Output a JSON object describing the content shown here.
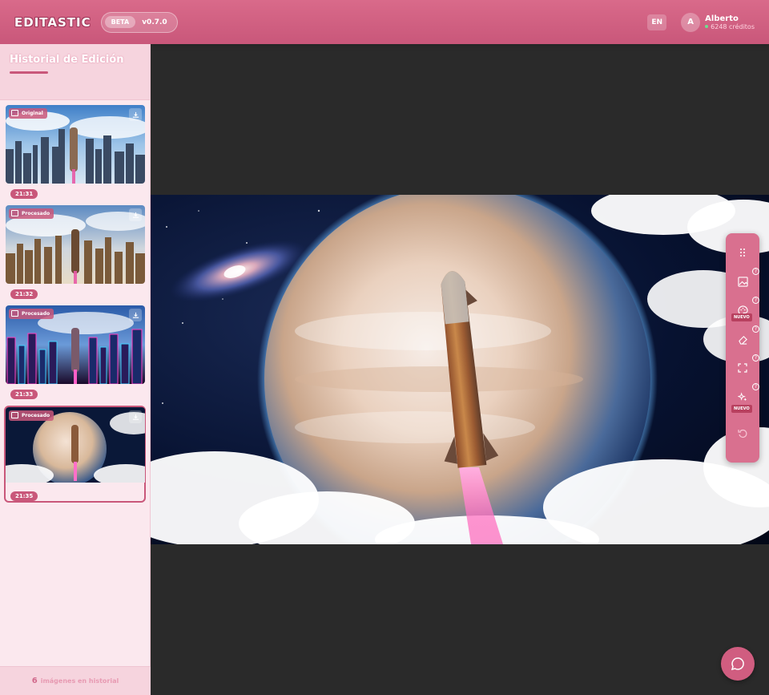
{
  "app": {
    "logo": "EDITASTIC",
    "beta_label": "BETA",
    "version": "v0.7.0"
  },
  "header": {
    "language": "EN",
    "user": {
      "initial": "A",
      "name": "Alberto",
      "credits": "6248 créditos"
    }
  },
  "sidebar": {
    "title": "Historial de Edición",
    "footer_count": "6",
    "footer_text": "imágenes en historial",
    "items": [
      {
        "tag": "Original",
        "time": "21:31"
      },
      {
        "tag": "Procesado",
        "time": "21:32"
      },
      {
        "tag": "Procesado",
        "time": "21:33"
      },
      {
        "tag": "Procesado",
        "time": "21:35"
      }
    ]
  },
  "tools": {
    "items": [
      "drag-handle-icon",
      "image-edit-icon",
      "palette-icon",
      "eraser-icon",
      "expand-icon",
      "sparkles-icon",
      "undo-icon"
    ],
    "new_label": "NUEVO"
  },
  "colors": {
    "brand": "#c9577a",
    "header": "#d96a8a",
    "sidebar_bg": "#fbe8ee",
    "canvas_bg": "#2a2a2a"
  }
}
